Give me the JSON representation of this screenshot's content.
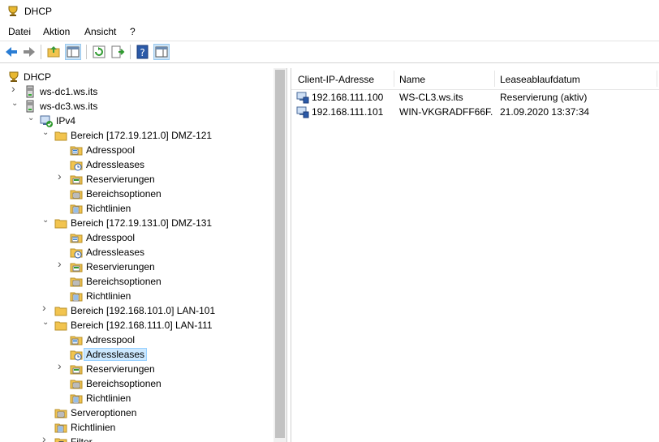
{
  "window": {
    "title": "DHCP"
  },
  "menu": [
    "Datei",
    "Aktion",
    "Ansicht",
    "?"
  ],
  "tree": {
    "root": "DHCP",
    "servers": [
      "ws-dc1.ws.its",
      "ws-dc3.ws.its"
    ],
    "ipv4": "IPv4",
    "scopes": [
      "Bereich [172.19.121.0] DMZ-121",
      "Bereich [172.19.131.0] DMZ-131",
      "Bereich [192.168.101.0] LAN-101",
      "Bereich [192.168.111.0] LAN-111"
    ],
    "scope_children": [
      "Adresspool",
      "Adressleases",
      "Reservierungen",
      "Bereichsoptionen",
      "Richtlinien"
    ],
    "server_options": "Serveroptionen",
    "policies": "Richtlinien",
    "filter": "Filter"
  },
  "list": {
    "columns": [
      "Client-IP-Adresse",
      "Name",
      "Leaseablaufdatum"
    ],
    "rows": [
      {
        "ip": "192.168.111.100",
        "name": "WS-CL3.ws.its",
        "expiry": "Reservierung (aktiv)"
      },
      {
        "ip": "192.168.111.101",
        "name": "WIN-VKGRADFF66F...",
        "expiry": "21.09.2020 13:37:34"
      }
    ]
  },
  "colors": {
    "selection": "#cce8ff",
    "folder": "#f2c44f",
    "accent": "#2a7dd4"
  }
}
